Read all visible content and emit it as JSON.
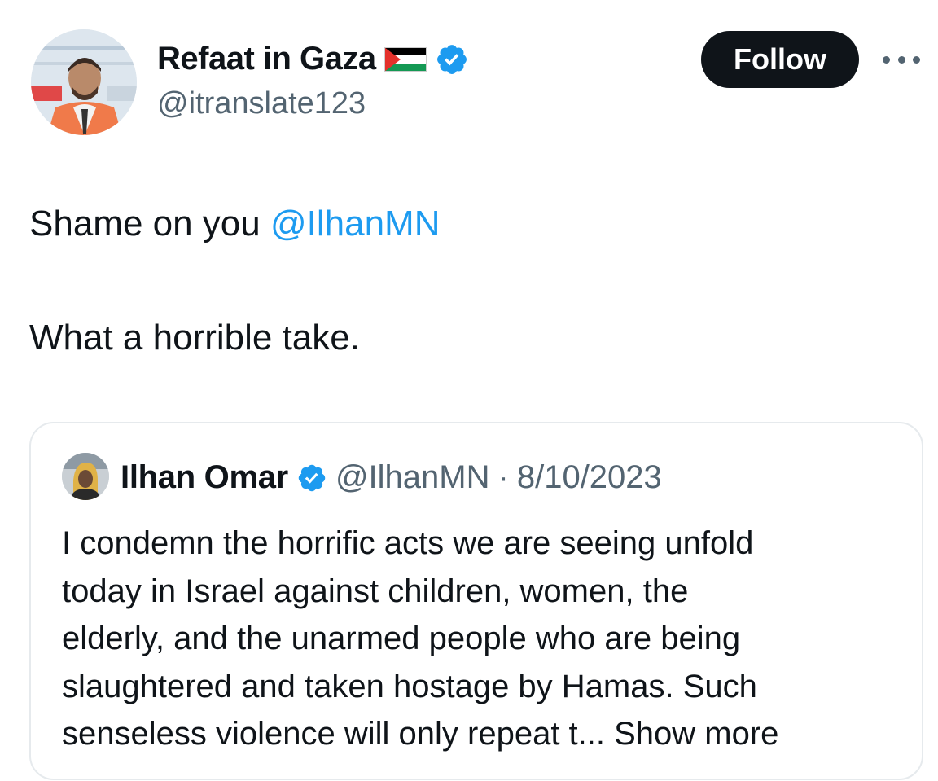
{
  "author": {
    "display_name": "Refaat in Gaza",
    "handle": "@itranslate123"
  },
  "actions": {
    "follow_label": "Follow"
  },
  "tweet": {
    "line1_prefix": "Shame on you ",
    "mention": "@IlhanMN",
    "line2": "What a horrible take."
  },
  "quote": {
    "display_name": "Ilhan Omar",
    "handle": "@IlhanMN",
    "separator": "·",
    "date": "8/10/2023",
    "lines": [
      "I condemn the horrific acts we are seeing unfold",
      "today in Israel against children, women, the",
      "elderly, and the unarmed people who are being",
      "slaughtered and taken hostage by Hamas. Such",
      "senseless violence will only repeat t..."
    ],
    "show_more": "Show more"
  },
  "colors": {
    "text": "#0f1419",
    "secondary": "#536471",
    "link": "#1d9bf0",
    "verified": "#1d9bf0",
    "border": "#e6eaed"
  },
  "icons": {
    "flag": "palestine-flag-icon",
    "verified": "verified-badge-icon",
    "more": "more-options-icon"
  }
}
